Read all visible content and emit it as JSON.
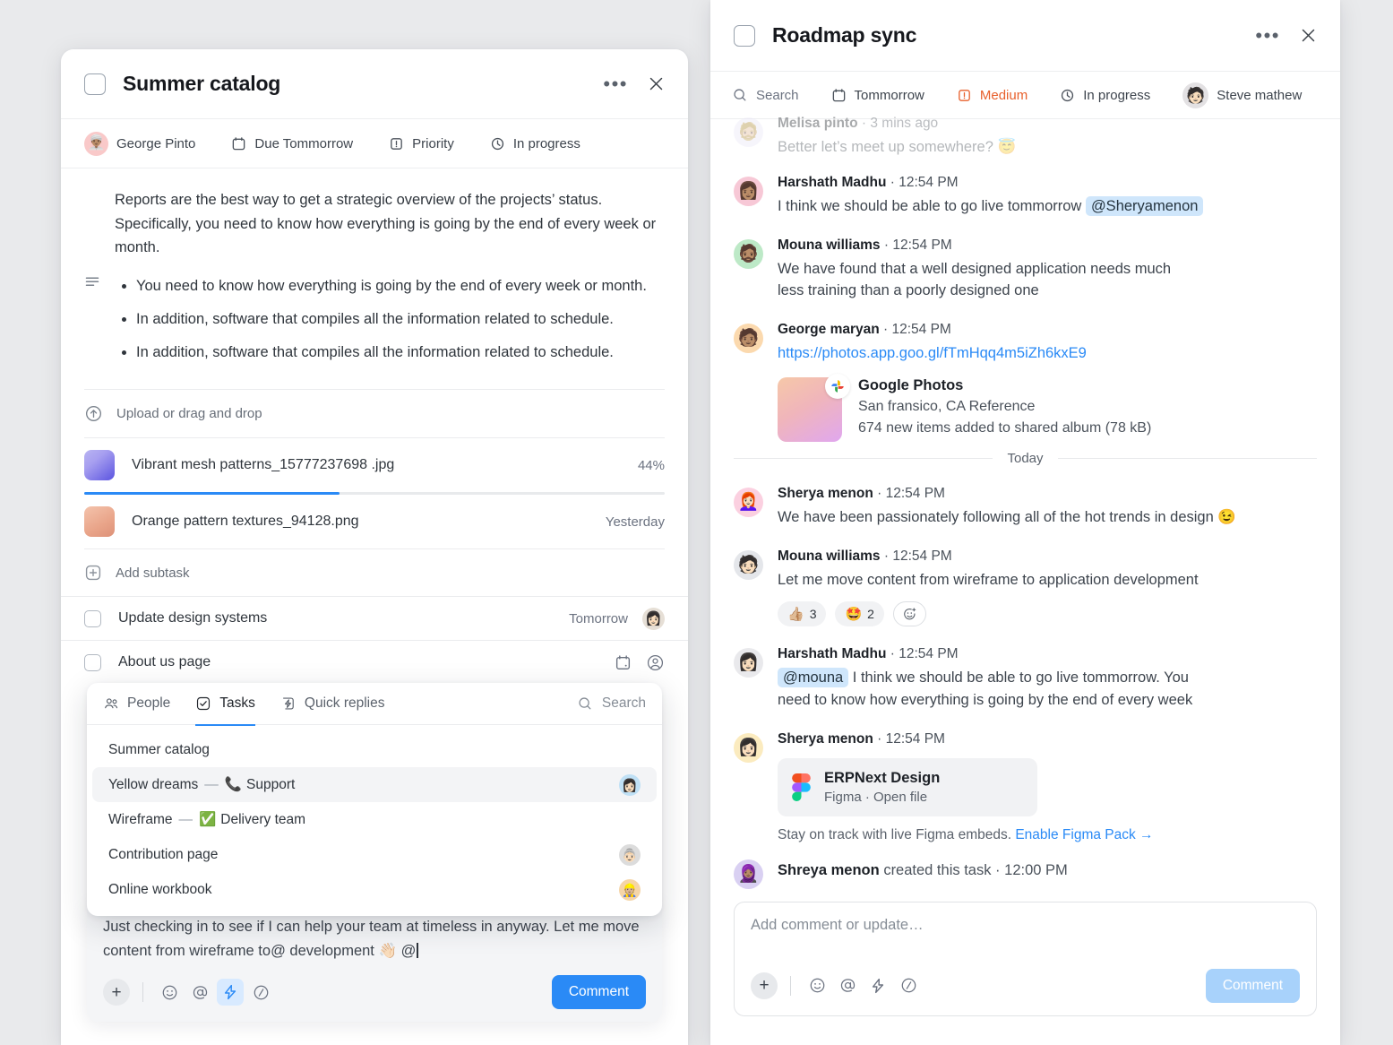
{
  "background_color": "#e9eaec",
  "accent_color": "#2a8af6",
  "left_panel": {
    "title": "Summer catalog",
    "checkbox_checked": false,
    "more_label": "•••",
    "close_label": "✕",
    "meta": [
      {
        "icon": "avatar-icon",
        "label": "George Pinto",
        "emoji": "👳🏽‍♂️",
        "bg": "#f9c9c9"
      },
      {
        "icon": "calendar-icon",
        "label": "Due Tommorrow"
      },
      {
        "icon": "priority-icon",
        "label": "Priority"
      },
      {
        "icon": "clock-icon",
        "label": "In progress"
      }
    ],
    "description": {
      "icon": "description-icon",
      "paragraph": "Reports are the best way to get a strategic overview of the projects’ status. Specifically, you need to know how everything is going by the end of every week or month.",
      "bullets": [
        "You need to know how everything is going by the end of every week or month.",
        "In addition, software that compiles all the information related to schedule.",
        "In addition, software that compiles all the information related to schedule."
      ]
    },
    "upload": {
      "icon": "upload-icon",
      "label": "Upload or drag and drop"
    },
    "files": [
      {
        "name": "Vibrant mesh patterns_15777237698 .jpg",
        "right_label": "44%",
        "progress": 44,
        "thumb": "mesh-thumbnail"
      },
      {
        "name": "Orange pattern textures_94128.png",
        "right_label": "Yesterday",
        "progress": null,
        "thumb": "orange-thumbnail"
      }
    ],
    "subtasks": {
      "add_label": "Add subtask",
      "add_icon": "plus-square-icon",
      "items": [
        {
          "name": "Update design systems",
          "date": "Tomorrow",
          "avatar_emoji": "👩🏻",
          "avatar_bg": "#e6dfd6",
          "has_avatar": true,
          "has_date_icon": false,
          "has_user_icon": false
        },
        {
          "name": "About us page",
          "date": "",
          "avatar_emoji": "",
          "avatar_bg": "",
          "has_avatar": false,
          "has_date_icon": true,
          "has_user_icon": true
        }
      ]
    },
    "composer": {
      "text": "Just checking in to see if I can help your team at timeless in anyway. Let me move content from wireframe to@ development 👋🏻 @",
      "plus_icon": "plus-icon",
      "tools": [
        {
          "icon": "emoji-icon",
          "active": false
        },
        {
          "icon": "mention-icon",
          "active": false
        },
        {
          "icon": "lightning-icon",
          "active": true
        },
        {
          "icon": "slash-command-icon",
          "active": false
        }
      ],
      "submit_label": "Comment",
      "submit_disabled": false
    },
    "popup": {
      "tabs": [
        {
          "label": "People",
          "icon": "people-icon",
          "selected": false
        },
        {
          "label": "Tasks",
          "icon": "check-square-icon",
          "selected": true
        },
        {
          "label": "Quick replies",
          "icon": "quick-reply-icon",
          "selected": false
        }
      ],
      "search_label": "Search",
      "search_icon": "search-icon",
      "items": [
        {
          "label": "Summer catalog",
          "suffix": "",
          "suffix_emoji": "",
          "highlighted": false,
          "avatar_emoji": "",
          "avatar_bg": ""
        },
        {
          "label": "Yellow dreams",
          "suffix": "Support",
          "suffix_emoji": "📞",
          "highlighted": true,
          "avatar_emoji": "👩🏻",
          "avatar_bg": "#bfe0f5"
        },
        {
          "label": "Wireframe",
          "suffix": "Delivery team",
          "suffix_emoji": "✅",
          "highlighted": false,
          "avatar_emoji": "",
          "avatar_bg": ""
        },
        {
          "label": "Contribution page",
          "suffix": "",
          "suffix_emoji": "",
          "highlighted": false,
          "avatar_emoji": "👵🏻",
          "avatar_bg": "#dcdcdc"
        },
        {
          "label": "Online workbook",
          "suffix": "",
          "suffix_emoji": "",
          "highlighted": false,
          "avatar_emoji": "👷🏼",
          "avatar_bg": "#f5d5a8"
        }
      ]
    }
  },
  "right_panel": {
    "title": "Roadmap sync",
    "checkbox_checked": false,
    "more_label": "•••",
    "close_label": "✕",
    "meta": [
      {
        "icon": "search-icon",
        "label": "Search",
        "warn": false
      },
      {
        "icon": "calendar-icon",
        "label": "Tommorrow",
        "warn": false
      },
      {
        "icon": "priority-icon",
        "label": "Medium",
        "warn": true
      },
      {
        "icon": "clock-icon",
        "label": "In progress",
        "warn": false
      },
      {
        "icon": "avatar-icon",
        "label": "Steve mathew",
        "warn": false,
        "emoji": "🧑🏻",
        "bg": "#e3e1e3"
      }
    ],
    "messages": [
      {
        "type": "text",
        "faded": true,
        "author": "Melisa pinto",
        "time": "3 mins ago",
        "avatar_emoji": "🧔🏼",
        "avatar_bg": "#e8e6f7",
        "text": "Better let’s meet up somewhere? 😇",
        "mention": "",
        "mention_position": ""
      },
      {
        "type": "text",
        "faded": false,
        "author": "Harshath Madhu",
        "time": "12:54 PM",
        "avatar_emoji": "👩🏽",
        "avatar_bg": "#f7c8d6",
        "text": "I think we should be able to go live tommorrow",
        "mention": "@Sheryamenon",
        "mention_position": "after"
      },
      {
        "type": "text",
        "faded": false,
        "author": "Mouna williams",
        "time": "12:54 PM",
        "avatar_emoji": "🧔🏽",
        "avatar_bg": "#bde9c7",
        "text": "We have found that a well designed application needs much less training than a poorly designed one",
        "mention": "",
        "mention_position": ""
      },
      {
        "type": "link_card",
        "faded": false,
        "author": "George maryan",
        "time": "12:54 PM",
        "avatar_emoji": "🧑🏽",
        "avatar_bg": "#fbd9ae",
        "url": "https://photos.app.goo.gl/fTmHqq4m5iZh6kxE9",
        "card": {
          "title": "Google Photos",
          "subtitle": "San fransico, CA Reference",
          "detail": "674 new items added to shared album (78 kB)",
          "badge_icon": "google-photos-icon"
        }
      },
      {
        "type": "divider",
        "label": "Today"
      },
      {
        "type": "text",
        "faded": false,
        "author": "Sherya menon",
        "time": "12:54 PM",
        "avatar_emoji": "👩🏻‍🦰",
        "avatar_bg": "#fbd0e0",
        "text": "We have been passionately following all of the hot trends in design 😉",
        "mention": "",
        "mention_position": ""
      },
      {
        "type": "reactions",
        "faded": false,
        "author": "Mouna williams",
        "time": "12:54 PM",
        "avatar_emoji": "🧑🏻",
        "avatar_bg": "#e4e6ea",
        "text": "Let me move content from wireframe to application development",
        "reactions": [
          {
            "emoji": "👍🏼",
            "count": "3"
          },
          {
            "emoji": "🤩",
            "count": "2"
          },
          {
            "emoji": "add-reaction-icon",
            "count": ""
          }
        ]
      },
      {
        "type": "text",
        "faded": false,
        "author": "Harshath Madhu",
        "time": "12:54 PM",
        "avatar_emoji": "👩🏻",
        "avatar_bg": "#e9e9ec",
        "text": "I think we should be able to go live tommorrow. You need to know how everything is going by the end of every week",
        "mention": "@mouna",
        "mention_position": "before"
      },
      {
        "type": "figma_card",
        "faded": false,
        "author": "Sherya menon",
        "time": "12:54 PM",
        "avatar_emoji": "👩🏻",
        "avatar_bg": "#fbebbf",
        "card": {
          "title": "ERPNext Design",
          "subtitle": "Figma · Open file",
          "icon": "figma-icon"
        },
        "note_text": "Stay on track with live Figma embeds.",
        "note_link": "Enable Figma Pack →"
      },
      {
        "type": "system",
        "faded": false,
        "author": "Shreya menon",
        "avatar_emoji": "🧕🏽",
        "avatar_bg": "#d9d0f2",
        "action": "created this task",
        "time": "12:00 PM"
      }
    ],
    "composer": {
      "placeholder": "Add comment or update…",
      "plus_icon": "plus-icon",
      "tools": [
        {
          "icon": "emoji-icon",
          "active": false
        },
        {
          "icon": "mention-icon",
          "active": false
        },
        {
          "icon": "lightning-icon",
          "active": false
        },
        {
          "icon": "slash-command-icon",
          "active": false
        }
      ],
      "submit_label": "Comment",
      "submit_disabled": true
    }
  }
}
